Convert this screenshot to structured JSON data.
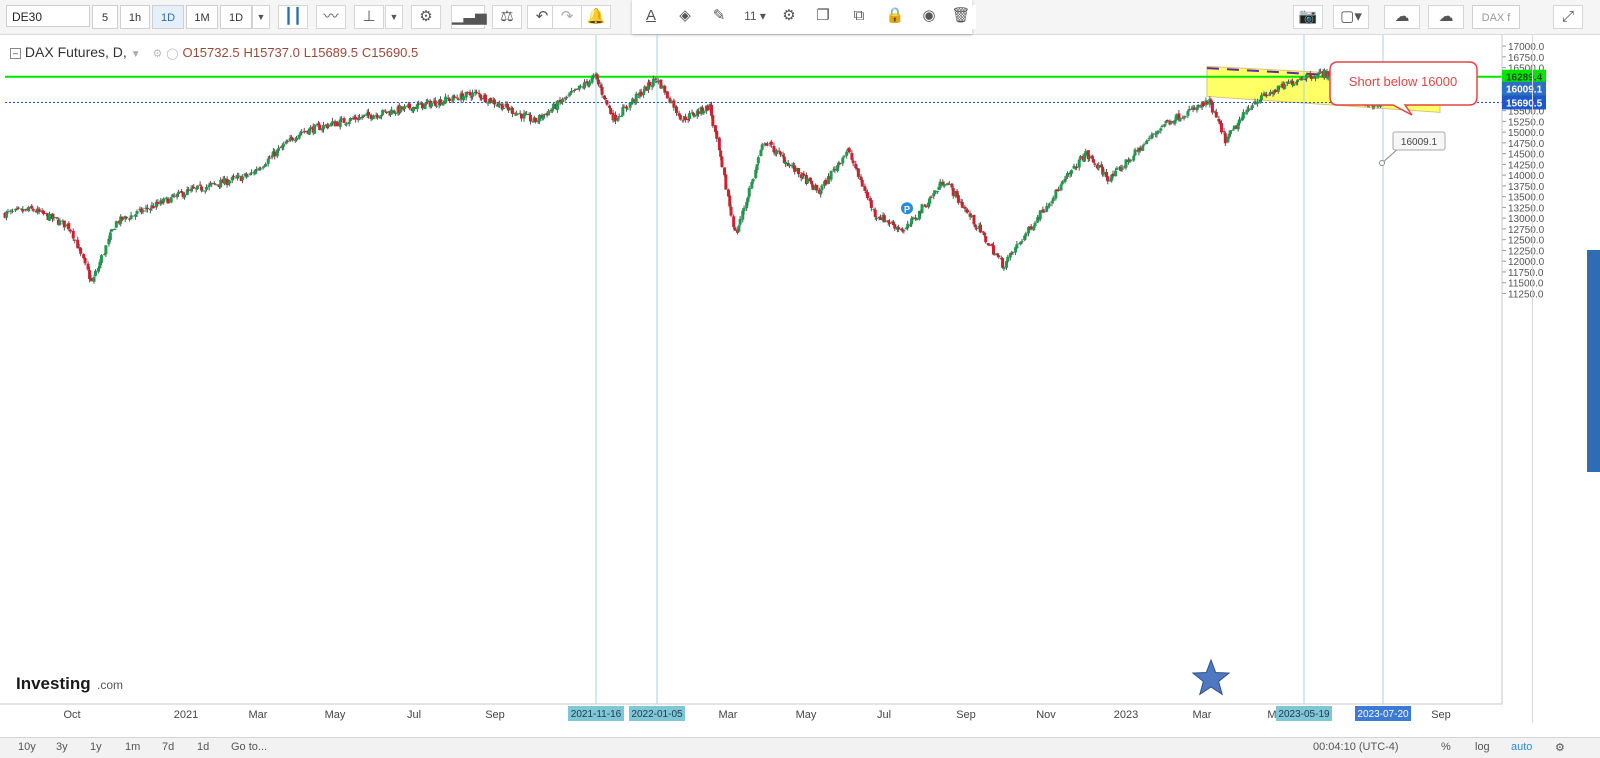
{
  "toolbar": {
    "symbol": "DE30",
    "intervals": [
      "5",
      "1h",
      "1D",
      "1M",
      "1D"
    ],
    "active_interval_index": 2,
    "font_size_value": "11",
    "right_label": "DAX f"
  },
  "legend": {
    "title": "DAX Futures, D,",
    "open": "O15732.5",
    "high": "H15737.0",
    "low": "L15689.5",
    "close": "C15690.5"
  },
  "chart_data": {
    "type": "candlestick",
    "title": "DAX Futures, D,",
    "x_tick_labels": [
      "Oct",
      "2021",
      "Mar",
      "May",
      "Jul",
      "Sep",
      "Mar",
      "May",
      "Jul",
      "Sep",
      "Nov",
      "2023",
      "Mar",
      "M",
      "Sep"
    ],
    "y_tick_labels": [
      "17000.0",
      "16750.0",
      "16500.0",
      "16250.0",
      "16000.0",
      "15750.0",
      "15500.0",
      "15250.0",
      "15000.0",
      "14750.0",
      "14500.0",
      "14250.0",
      "14000.0",
      "13750.0",
      "13500.0",
      "13250.0",
      "13000.0",
      "12750.0",
      "12500.0",
      "12250.0",
      "12000.0",
      "11750.0",
      "11500.0",
      "11250.0"
    ],
    "ylim": [
      11000,
      17150
    ],
    "close_path": [
      {
        "date": "2020-09-01",
        "close": 13100
      },
      {
        "date": "2020-09-20",
        "close": 13200
      },
      {
        "date": "2020-10-15",
        "close": 12800
      },
      {
        "date": "2020-10-30",
        "close": 11500
      },
      {
        "date": "2020-11-15",
        "close": 12900
      },
      {
        "date": "2021-01-01",
        "close": 13600
      },
      {
        "date": "2021-02-20",
        "close": 14000
      },
      {
        "date": "2021-03-31",
        "close": 15000
      },
      {
        "date": "2021-05-10",
        "close": 15300
      },
      {
        "date": "2021-06-30",
        "close": 15600
      },
      {
        "date": "2021-08-15",
        "close": 15900
      },
      {
        "date": "2021-09-30",
        "close": 15250
      },
      {
        "date": "2021-11-16",
        "close": 16290
      },
      {
        "date": "2021-12-01",
        "close": 15300
      },
      {
        "date": "2022-01-05",
        "close": 16250
      },
      {
        "date": "2022-01-25",
        "close": 15300
      },
      {
        "date": "2022-02-15",
        "close": 15600
      },
      {
        "date": "2022-03-07",
        "close": 12600
      },
      {
        "date": "2022-03-29",
        "close": 14800
      },
      {
        "date": "2022-05-10",
        "close": 13600
      },
      {
        "date": "2022-06-01",
        "close": 14600
      },
      {
        "date": "2022-06-22",
        "close": 13100
      },
      {
        "date": "2022-07-15",
        "close": 12700
      },
      {
        "date": "2022-08-15",
        "close": 13900
      },
      {
        "date": "2022-09-29",
        "close": 11900
      },
      {
        "date": "2022-11-01",
        "close": 13300
      },
      {
        "date": "2022-12-01",
        "close": 14500
      },
      {
        "date": "2022-12-20",
        "close": 13900
      },
      {
        "date": "2023-01-31",
        "close": 15200
      },
      {
        "date": "2023-03-07",
        "close": 15700
      },
      {
        "date": "2023-03-20",
        "close": 14800
      },
      {
        "date": "2023-04-10",
        "close": 15700
      },
      {
        "date": "2023-05-19",
        "close": 16300
      },
      {
        "date": "2023-06-16",
        "close": 16400
      },
      {
        "date": "2023-07-10",
        "close": 15600
      },
      {
        "date": "2023-07-20",
        "close": 15690.5
      }
    ],
    "horizontal_lines": [
      {
        "price": 16289.4,
        "label": "16289.4",
        "color": "#00e600"
      },
      {
        "price": 15690.5,
        "label": "15690.5",
        "color": "#1d58c8"
      }
    ],
    "price_marker": {
      "price": 16009.1,
      "label": "16009.1",
      "color": "#2d6fc0"
    },
    "vertical_markers": [
      {
        "date": "2021-11-16",
        "label": "2021-11-16"
      },
      {
        "date": "2022-01-05",
        "label": "2022-01-05"
      },
      {
        "date": "2023-05-19",
        "label": "2023-05-19"
      },
      {
        "date": "2023-07-20",
        "label": "2023-07-20"
      }
    ],
    "channel_color": "#ffff66",
    "annotation": "Short below 16000",
    "callout_value": "16009.1",
    "up_color": "#1e9b4c",
    "down_color": "#d0202e",
    "grid": false
  },
  "watermark": {
    "brand": "Investing",
    "suffix": ".com"
  },
  "bottom": {
    "ranges": [
      "10y",
      "3y",
      "1y",
      "1m",
      "7d",
      "1d",
      "Go to..."
    ],
    "time": "00:04:10 (UTC-4)",
    "percent": "%",
    "log": "log",
    "auto": "auto"
  }
}
